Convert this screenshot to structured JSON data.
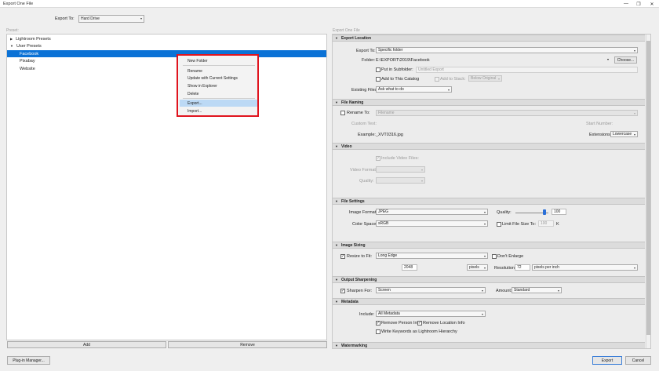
{
  "window": {
    "title": "Export One File",
    "minimize_glyph": "—",
    "maximize_glyph": "❐",
    "close_glyph": "✕"
  },
  "export_to": {
    "label": "Export To:",
    "value": "Hard Drive"
  },
  "left_panel": {
    "label": "Preset:",
    "tree": [
      {
        "label": "Lightroom Presets",
        "toggle": "▶"
      },
      {
        "label": "User Presets",
        "toggle": "▼"
      },
      {
        "label": "Facebook"
      },
      {
        "label": "Pixabay"
      },
      {
        "label": "Website"
      }
    ],
    "add_button": "Add",
    "remove_button": "Remove"
  },
  "context_menu": {
    "items": [
      "New Folder",
      "Rename",
      "Update with Current Settings",
      "Show in Explorer",
      "Delete",
      "Export...",
      "Import..."
    ],
    "highlight_color": "#e0141e"
  },
  "right_panel": {
    "label": "Export One File",
    "export_location": {
      "header": "Export Location",
      "export_to_label": "Export To:",
      "export_to_value": "Specific folder",
      "folder_label": "Folder:",
      "folder_value": "E:\\EXPORT\\2019\\Facebook",
      "choose_button": "Choose...",
      "put_in_subfolder_label": "Put in Subfolder:",
      "subfolder_value": "Untitled Export",
      "add_to_catalog_label": "Add to This Catalog",
      "add_to_stack_label": "Add to Stack:",
      "stack_value": "Below Original",
      "existing_files_label": "Existing Files:",
      "existing_files_value": "Ask what to do"
    },
    "file_naming": {
      "header": "File Naming",
      "rename_to_label": "Rename To:",
      "rename_to_value": "Filename",
      "custom_text_label": "Custom Text:",
      "start_number_label": "Start Number:",
      "example_label": "Example:",
      "example_value": "_XVT0316.jpg",
      "extensions_label": "Extensions:",
      "extensions_value": "Lowercase"
    },
    "video": {
      "header": "Video",
      "include_label": "Include Video Files:",
      "format_label": "Video Format:",
      "quality_label": "Quality:"
    },
    "file_settings": {
      "header": "File Settings",
      "image_format_label": "Image Format:",
      "image_format_value": "JPEG",
      "quality_label": "Quality:",
      "quality_value": "100",
      "quality_fraction": 1.0,
      "color_space_label": "Color Space:",
      "color_space_value": "sRGB",
      "limit_size_label": "Limit File Size To:",
      "limit_size_value": "100",
      "limit_size_unit": "K"
    },
    "image_sizing": {
      "header": "Image Sizing",
      "resize_label": "Resize to Fit:",
      "resize_value": "Long Edge",
      "dont_enlarge_label": "Don't Enlarge",
      "size_value": "2048",
      "unit_value": "pixels",
      "resolution_label": "Resolution:",
      "resolution_value": "72",
      "resolution_unit": "pixels per inch"
    },
    "output_sharpening": {
      "header": "Output Sharpening",
      "sharpen_label": "Sharpen For:",
      "sharpen_value": "Screen",
      "amount_label": "Amount:",
      "amount_value": "Standard"
    },
    "metadata": {
      "header": "Metadata",
      "include_label": "Include:",
      "include_value": "All Metadata",
      "remove_person_label": "Remove Person Info",
      "remove_location_label": "Remove Location Info",
      "write_keywords_label": "Write Keywords as Lightroom Hierarchy"
    },
    "watermarking": {
      "header": "Watermarking"
    }
  },
  "footer": {
    "plugin_manager": "Plug-in Manager...",
    "export": "Export",
    "cancel": "Cancel"
  },
  "icons": {
    "check": "✓",
    "dropdown": "▾",
    "section_expanded": "▼"
  }
}
